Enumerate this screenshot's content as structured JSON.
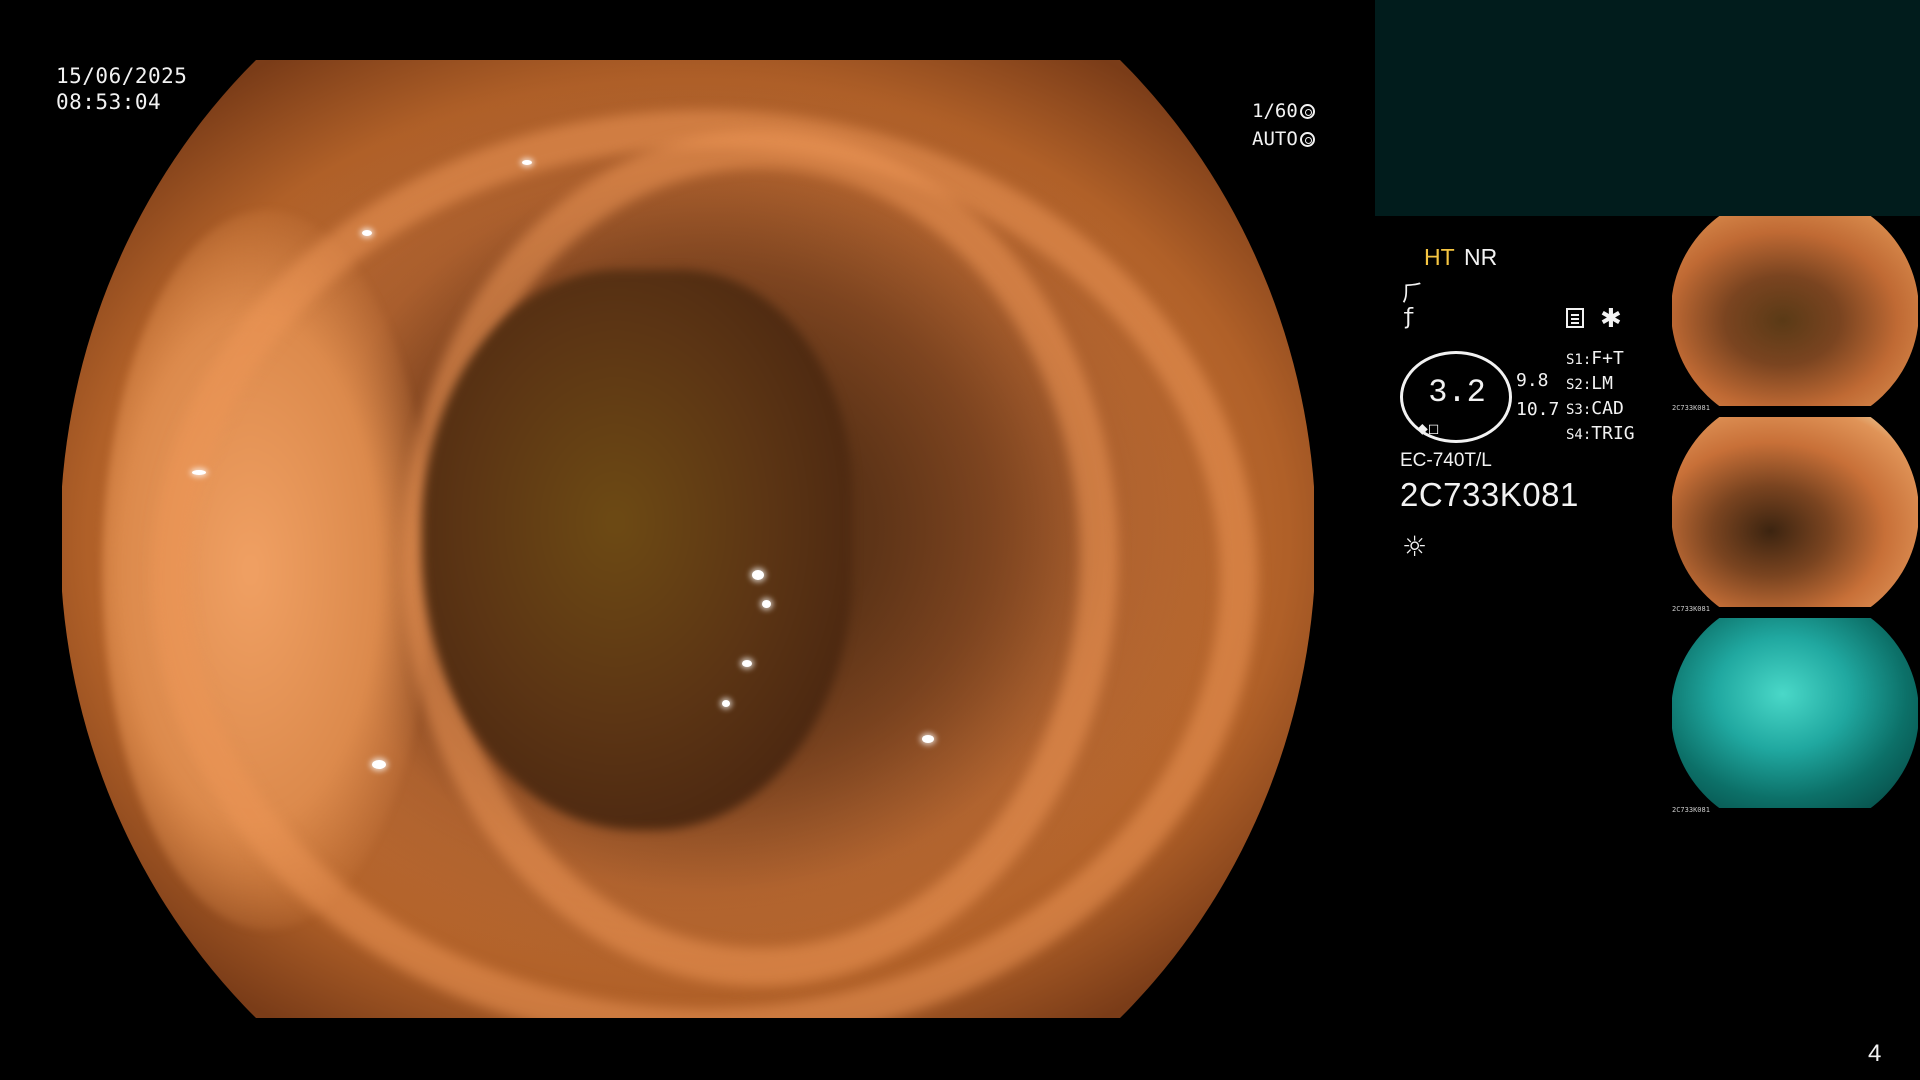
{
  "timestamp": {
    "date": "15/06/2025",
    "time": "08:53:04"
  },
  "exposure": {
    "shutter": "1/60",
    "mode": "AUTO",
    "shutter_icon": "aperture-icon",
    "mode_icon": "iris-icon"
  },
  "processing": {
    "ht": "HT",
    "nr": "NR",
    "ht_color": "#f5c542"
  },
  "icons": {
    "icon_a": "⺁",
    "icon_b": "ƒ",
    "icon_d": "✱",
    "light": "☼"
  },
  "gauge": {
    "value": "3.2",
    "marks": "◆◻"
  },
  "readouts": {
    "top": "9.8",
    "bottom": "10.7"
  },
  "switches": [
    {
      "key": "S1:",
      "value": "F+T"
    },
    {
      "key": "S2:",
      "value": "LM"
    },
    {
      "key": "S3:",
      "value": "CAD"
    },
    {
      "key": "S4:",
      "value": "TRIG"
    }
  ],
  "scope": {
    "model": "EC-740T/L",
    "serial": "2C733K081"
  },
  "thumbnails": [
    {
      "caption": "2C733K081",
      "tone": "orange"
    },
    {
      "caption": "2C733K081",
      "tone": "orange-bright"
    },
    {
      "caption": "2C733K081",
      "tone": "teal"
    }
  ],
  "page_number": "4",
  "colors": {
    "background": "#000000",
    "top_panel": "#011c1c",
    "text": "#f2f2f2"
  }
}
